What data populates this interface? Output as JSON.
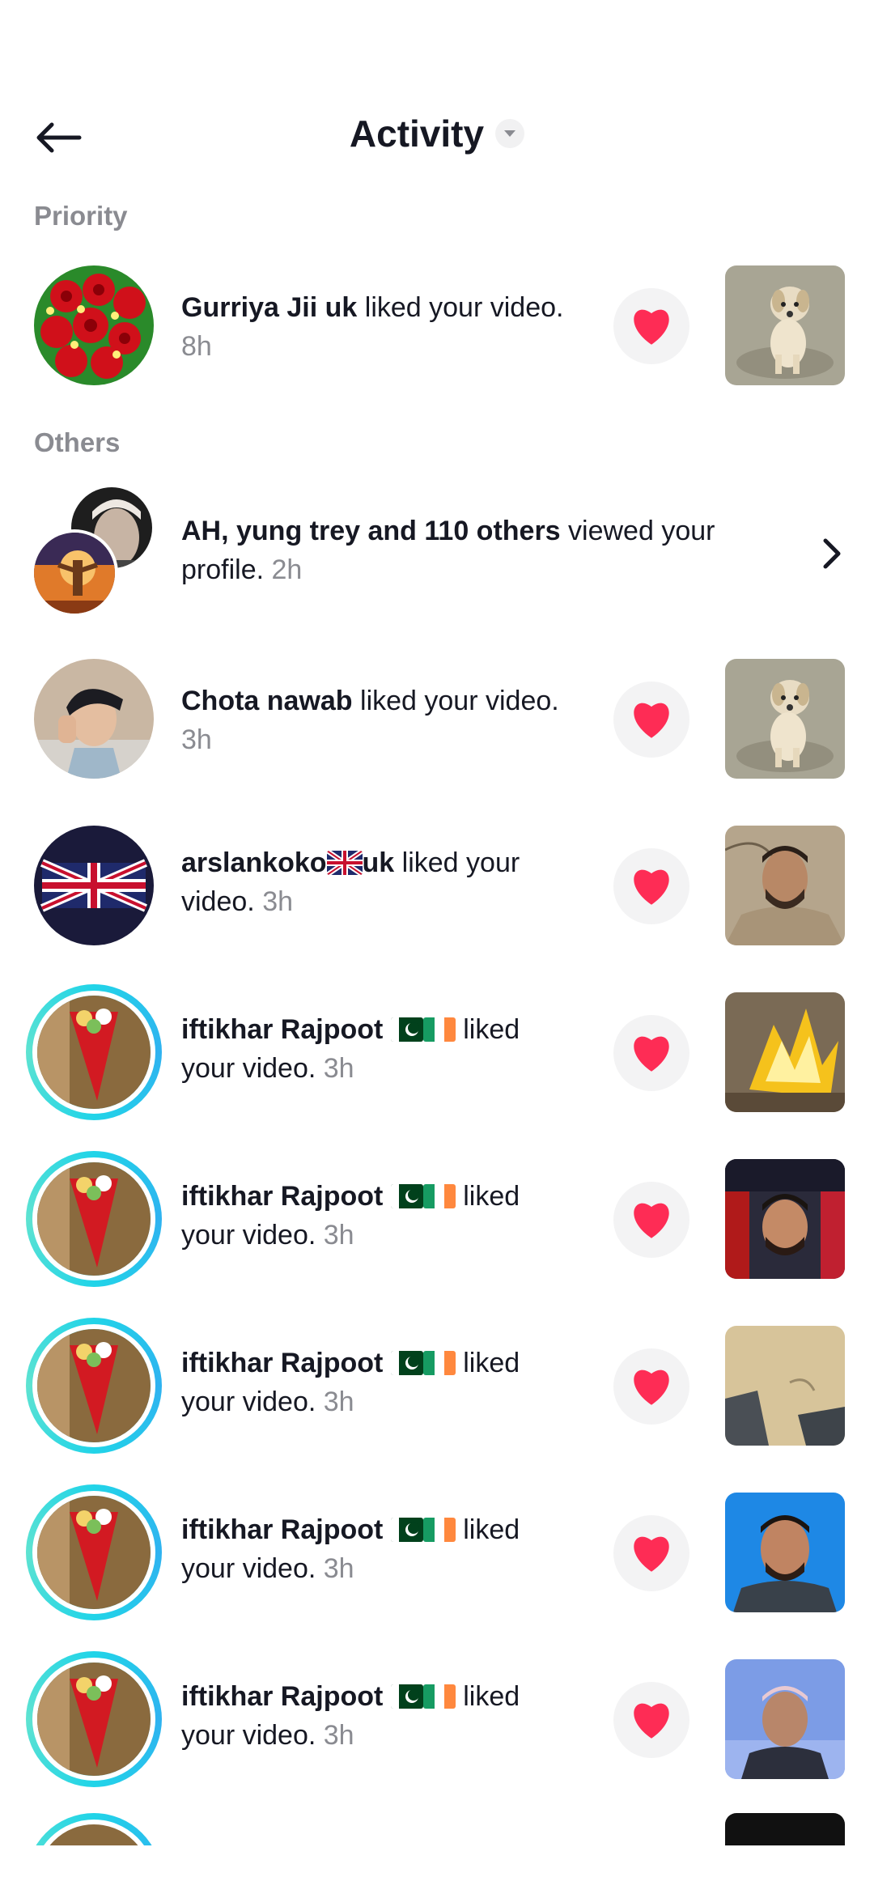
{
  "header": {
    "title": "Activity",
    "back_icon": "arrow-left-icon",
    "dropdown_icon": "caret-down-icon"
  },
  "sections": {
    "priority": "Priority",
    "others": "Others"
  },
  "priority_item": {
    "name": "Gurriya Jii uk",
    "action": " liked your video.",
    "time": "8h"
  },
  "profile_views": {
    "names": "AH, yung trey and 110 others",
    "action": " viewed your profile. ",
    "time": "2h"
  },
  "items": [
    {
      "name": "Chota nawab",
      "action": " liked your video.",
      "time": "3h"
    },
    {
      "name": "arslankoko",
      "name_suffix": "uk",
      "action": " liked your video. ",
      "time": "3h"
    },
    {
      "name": "iftikhar Rajpoot ",
      "action": " liked your video. ",
      "time": "3h"
    },
    {
      "name": "iftikhar Rajpoot ",
      "action": " liked your video. ",
      "time": "3h"
    },
    {
      "name": "iftikhar Rajpoot ",
      "action": " liked your video. ",
      "time": "3h"
    },
    {
      "name": "iftikhar Rajpoot ",
      "action": " liked your video. ",
      "time": "3h"
    },
    {
      "name": "iftikhar Rajpoot ",
      "action": " liked your video. ",
      "time": "3h"
    }
  ],
  "colors": {
    "heart": "#fe2c55",
    "muted": "#8a8b91",
    "story_ring": "#21d4e8"
  }
}
